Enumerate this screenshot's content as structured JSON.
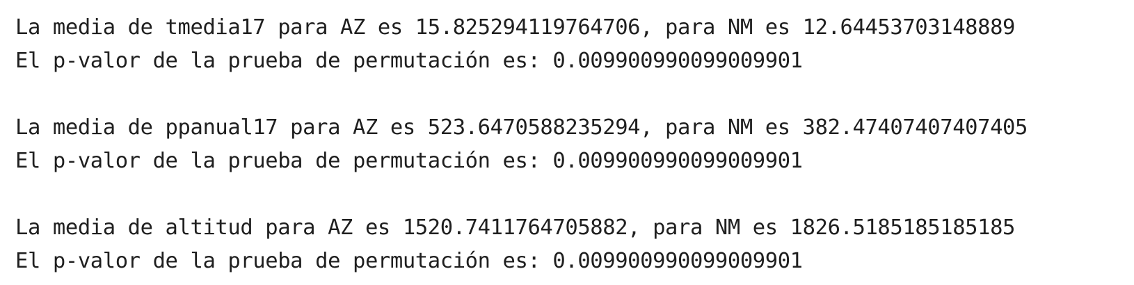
{
  "output": {
    "blocks": [
      {
        "mean_line": "La media de tmedia17 para AZ es 15.825294119764706, para NM es 12.64453703148889",
        "pvalue_line": "El p-valor de la prueba de permutación es: 0.009900990099009901"
      },
      {
        "mean_line": "La media de ppanual17 para AZ es 523.6470588235294, para NM es 382.47407407407405",
        "pvalue_line": "El p-valor de la prueba de permutación es: 0.009900990099009901"
      },
      {
        "mean_line": "La media de altitud para AZ es 1520.7411764705882, para NM es 1826.5185185185185",
        "pvalue_line": "El p-valor de la prueba de permutación es: 0.009900990099009901"
      }
    ]
  }
}
